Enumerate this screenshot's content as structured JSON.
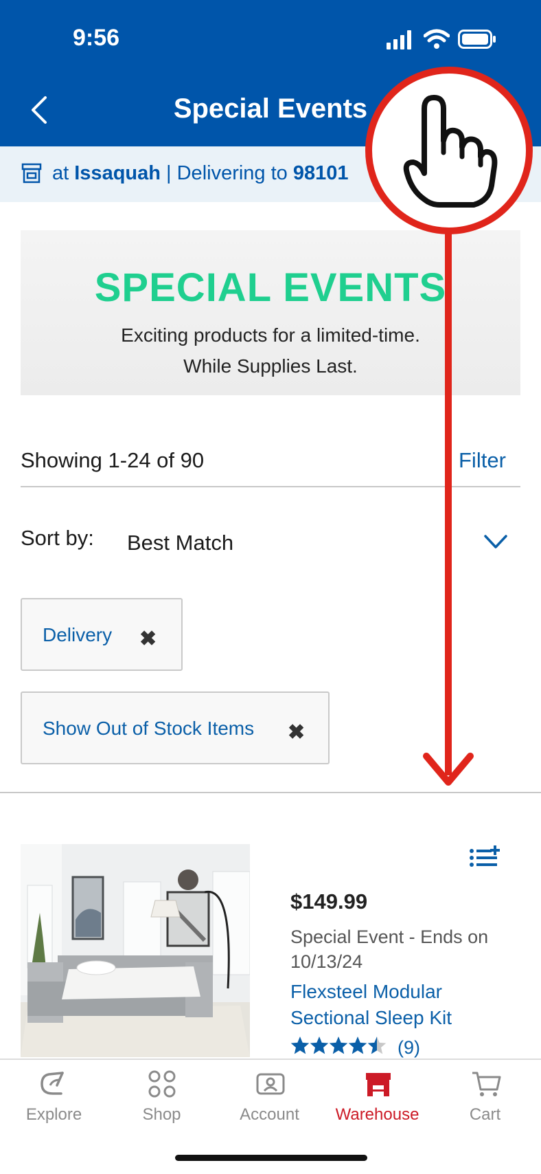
{
  "status_bar": {
    "time": "9:56"
  },
  "header": {
    "title": "Special Events"
  },
  "location": {
    "prefix": "at ",
    "store": "Issaquah",
    "separator": " | Delivering to ",
    "zip": "98101"
  },
  "banner": {
    "title": "SPECIAL EVENTS",
    "line1": "Exciting products for a limited-time.",
    "line2": "While Supplies Last."
  },
  "results": {
    "showing": "Showing 1-24 of 90",
    "filter_label": "Filter"
  },
  "sort": {
    "label": "Sort by:",
    "value": "Best Match"
  },
  "chips": [
    {
      "label": "Delivery",
      "remove": "✖"
    },
    {
      "label": "Show Out of Stock Items",
      "remove": "✖"
    }
  ],
  "product": {
    "price": "$149.99",
    "event_note": "Special Event - Ends on 10/13/24",
    "name": "Flexsteel Modular Sectional Sleep Kit",
    "rating": 4.5,
    "rating_count": "(9)"
  },
  "nav": [
    {
      "label": "Explore",
      "icon": "explore-icon",
      "active": false
    },
    {
      "label": "Shop",
      "icon": "shop-grid-icon",
      "active": false
    },
    {
      "label": "Account",
      "icon": "account-icon",
      "active": false
    },
    {
      "label": "Warehouse",
      "icon": "warehouse-icon",
      "active": true
    },
    {
      "label": "Cart",
      "icon": "cart-icon",
      "active": false
    }
  ],
  "colors": {
    "header_blue": "#0055aa",
    "link_blue": "#0a5fa8",
    "banner_green": "#1fcf8f",
    "active_red": "#cc1a26",
    "annotation_red": "#e0251b"
  }
}
